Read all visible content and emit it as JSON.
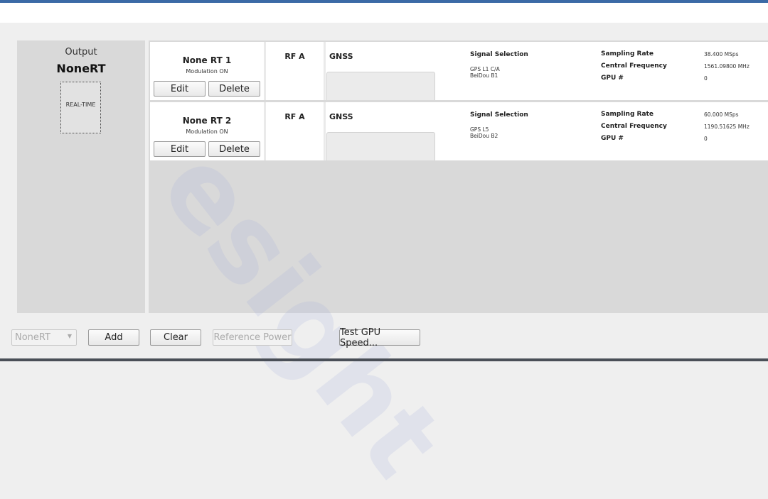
{
  "output_panel": {
    "label": "Output",
    "name": "NoneRT",
    "mode_box": "REAL-TIME"
  },
  "rows": [
    {
      "name": "None RT 1",
      "modulation": "Modulation ON",
      "edit_label": "Edit",
      "delete_label": "Delete",
      "rf": "RF A",
      "system": "GNSS",
      "signal_selection_label": "Signal Selection",
      "signals": [
        "GPS L1 C/A",
        "BeiDou B1"
      ],
      "sampling_rate_label": "Sampling Rate",
      "sampling_rate": "38.400 MSps",
      "central_frequency_label": "Central Frequency",
      "central_frequency": "1561.09800 MHz",
      "gpu_label": "GPU #",
      "gpu": "0"
    },
    {
      "name": "None RT 2",
      "modulation": "Modulation ON",
      "edit_label": "Edit",
      "delete_label": "Delete",
      "rf": "RF A",
      "system": "GNSS",
      "signal_selection_label": "Signal Selection",
      "signals": [
        "GPS L5",
        "BeiDou B2"
      ],
      "sampling_rate_label": "Sampling Rate",
      "sampling_rate": "60.000 MSps",
      "central_frequency_label": "Central Frequency",
      "central_frequency": "1190.51625 MHz",
      "gpu_label": "GPU #",
      "gpu": "0"
    }
  ],
  "bottom_bar": {
    "output_select": "NoneRT",
    "add_label": "Add",
    "clear_label": "Clear",
    "reference_power_label": "Reference Power",
    "test_gpu_label": "Test GPU Speed..."
  },
  "watermark": {
    "text": "esight"
  }
}
